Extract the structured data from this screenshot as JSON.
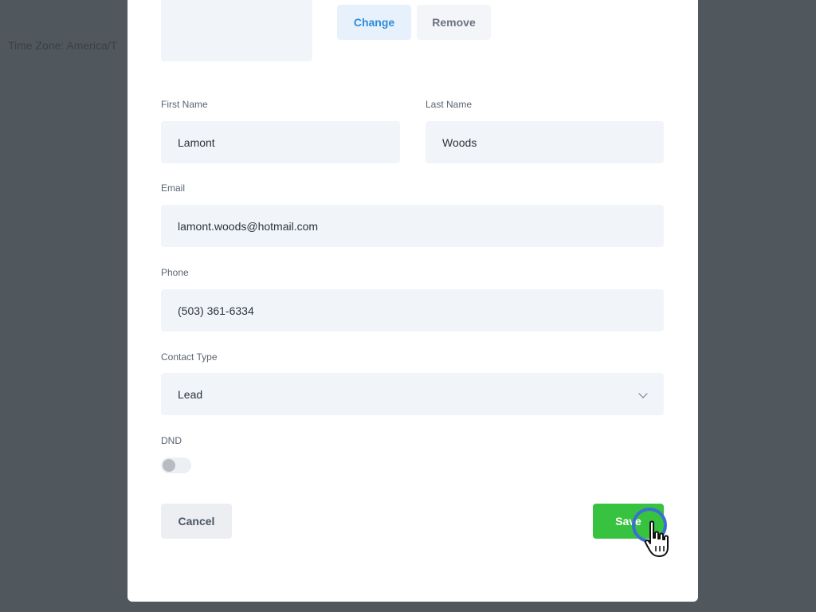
{
  "background": {
    "timezone_text": "Time Zone: America/T"
  },
  "modal": {
    "avatar": {
      "change_label": "Change",
      "remove_label": "Remove"
    },
    "first_name": {
      "label": "First Name",
      "value": "Lamont"
    },
    "last_name": {
      "label": "Last Name",
      "value": "Woods"
    },
    "email": {
      "label": "Email",
      "value": "lamont.woods@hotmail.com"
    },
    "phone": {
      "label": "Phone",
      "value": "(503) 361-6334"
    },
    "contact_type": {
      "label": "Contact Type",
      "value": "Lead",
      "icon": "chevron-down-icon"
    },
    "dnd": {
      "label": "DND",
      "enabled": false
    },
    "cancel_label": "Cancel",
    "save_label": "Save"
  },
  "colors": {
    "overlay": "#50575d",
    "accent_blue": "#2f8bd8",
    "save_green": "#37c23f",
    "field_bg": "#f1f5f9"
  }
}
